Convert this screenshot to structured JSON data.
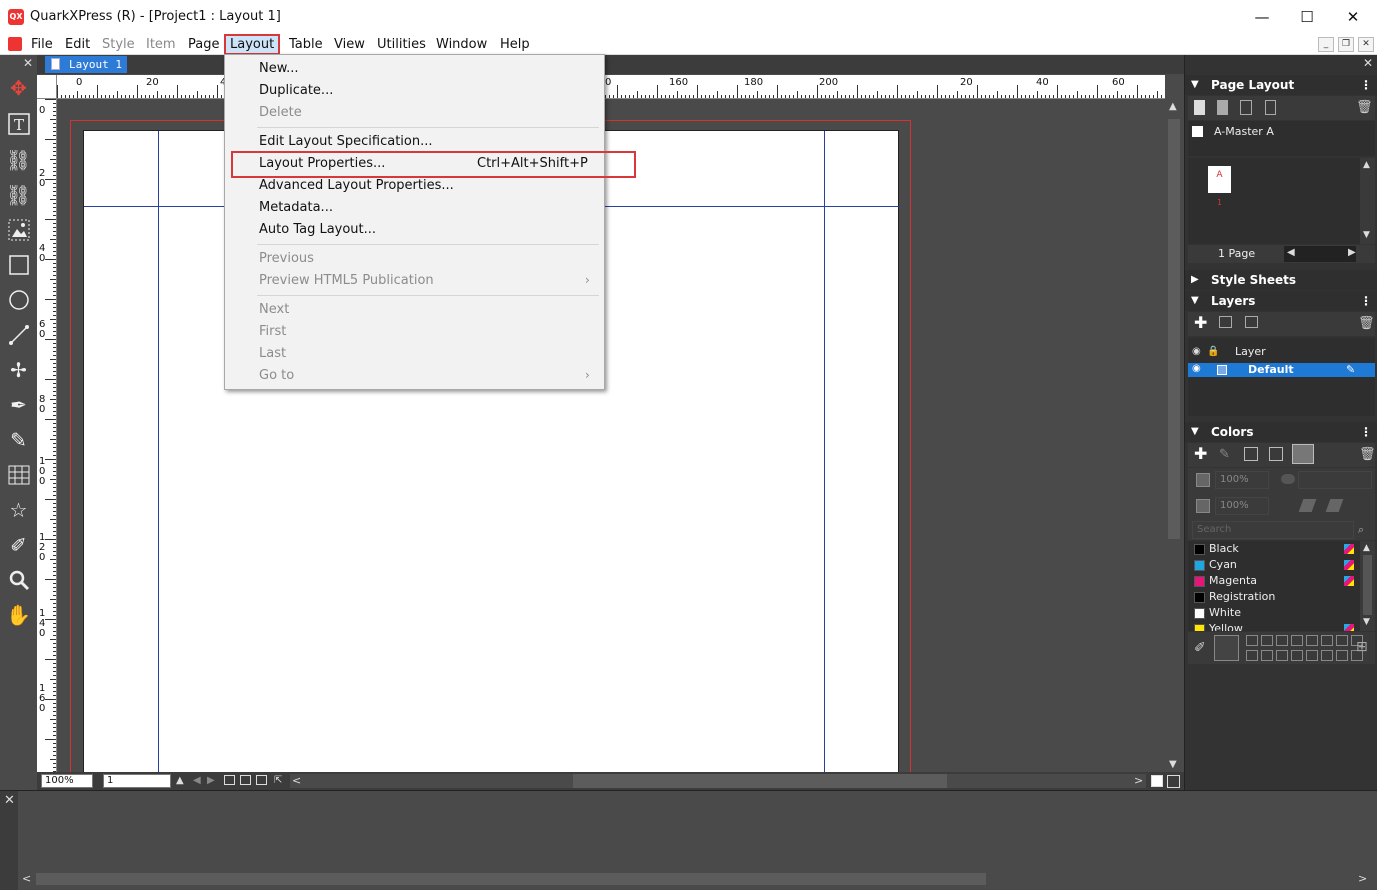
{
  "window": {
    "title": "QuarkXPress (R) - [Project1 : Layout 1]",
    "app_icon_text": "QX",
    "minimize": "—",
    "maximize": "☐",
    "close": "✕"
  },
  "menubar": {
    "items": [
      {
        "label": "File",
        "enabled": true
      },
      {
        "label": "Edit",
        "enabled": true
      },
      {
        "label": "Style",
        "enabled": false
      },
      {
        "label": "Item",
        "enabled": false
      },
      {
        "label": "Page",
        "enabled": true
      },
      {
        "label": "Layout",
        "enabled": true,
        "active": true
      },
      {
        "label": "Table",
        "enabled": true
      },
      {
        "label": "View",
        "enabled": true
      },
      {
        "label": "Utilities",
        "enabled": true
      },
      {
        "label": "Window",
        "enabled": true
      },
      {
        "label": "Help",
        "enabled": true
      }
    ],
    "mdi": {
      "minimize": "_",
      "restore": "❐",
      "close": "✕"
    }
  },
  "layout_menu": {
    "items": [
      {
        "label": "New...",
        "enabled": true
      },
      {
        "label": "Duplicate...",
        "enabled": true
      },
      {
        "label": "Delete",
        "enabled": false
      },
      {
        "label": "Edit Layout Specification...",
        "enabled": true
      },
      {
        "label": "Layout Properties...",
        "enabled": true,
        "shortcut": "Ctrl+Alt+Shift+P",
        "highlighted": true
      },
      {
        "label": "Advanced Layout Properties...",
        "enabled": true
      },
      {
        "label": "Metadata...",
        "enabled": true
      },
      {
        "label": "Auto Tag Layout...",
        "enabled": true
      },
      {
        "label": "Previous",
        "enabled": false
      },
      {
        "label": "Preview HTML5 Publication",
        "enabled": false,
        "submenu": true
      },
      {
        "label": "Next",
        "enabled": false
      },
      {
        "label": "First",
        "enabled": false
      },
      {
        "label": "Last",
        "enabled": false
      },
      {
        "label": "Go to",
        "enabled": false,
        "submenu": true
      }
    ],
    "submenu_glyph": "›"
  },
  "document": {
    "tab_label": "Layout 1",
    "tab_close": "✕",
    "hruler_labels": [
      "20",
      "0",
      "160",
      "180",
      "200",
      "20",
      "40",
      "60"
    ],
    "hruler_tick_mark": "4",
    "hruler_tick_mark2": "0",
    "vruler_labels": [
      "0",
      "2\n0",
      "4\n0",
      "6\n0",
      "8\n0",
      "1\n0\n0",
      "1\n2\n0",
      "1\n4\n0",
      "1\n6\n0"
    ]
  },
  "statusbar": {
    "zoom": "100%",
    "page": "1",
    "arrow_up": "▲",
    "arrow_left": "◀",
    "arrow_right": "▶",
    "scroll_left": "<",
    "scroll_right": ">"
  },
  "panels": {
    "page_layout": {
      "title": "Page Layout",
      "master_label": "A-Master A",
      "page_thumb_label": "A",
      "page_number": "1",
      "page_count": "1 Page"
    },
    "style_sheets": {
      "title": "Style Sheets"
    },
    "layers": {
      "title": "Layers",
      "column_label": "Layer",
      "default_layer": "Default"
    },
    "colors": {
      "title": "Colors",
      "opacity1": "100%",
      "opacity2": "100%",
      "search_placeholder": "Search",
      "list": [
        {
          "name": "Black",
          "color": "#000000",
          "cmyk": true
        },
        {
          "name": "Cyan",
          "color": "#1ea7e1",
          "cmyk": true
        },
        {
          "name": "Magenta",
          "color": "#e5157c",
          "cmyk": true
        },
        {
          "name": "Registration",
          "color": "#000000",
          "cmyk": false
        },
        {
          "name": "White",
          "color": "#ffffff",
          "cmyk": false
        },
        {
          "name": "Yellow",
          "color": "#ffe500",
          "cmyk": true
        }
      ]
    }
  },
  "colors": {
    "accent_blue": "#2d7bd6",
    "highlight_red": "#d9383a",
    "active_tool_red": "#e8463c",
    "guide_blue": "#2b3fa0",
    "bleed_red": "#d53333"
  },
  "icons": {
    "panel_collapse": "▼",
    "panel_expand": "▶",
    "kebab": "⋮"
  }
}
